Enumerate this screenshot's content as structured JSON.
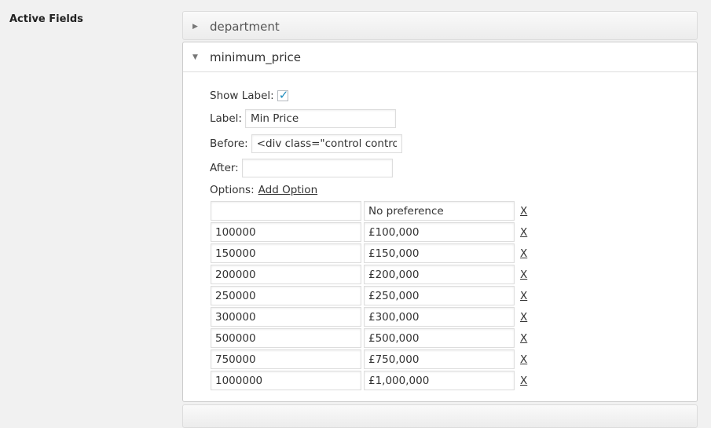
{
  "section_label": "Active Fields",
  "panels": {
    "department": "department",
    "minimum_price": "minimum_price"
  },
  "fields": {
    "show_label": "Show Label:",
    "show_label_checked": true,
    "label_label": "Label:",
    "label_value": "Min Price",
    "before_label": "Before:",
    "before_value": "<div class=\"control contro",
    "after_label": "After:",
    "after_value": "",
    "options_label": "Options:",
    "add_option": "Add Option"
  },
  "options": [
    {
      "key": "",
      "value": "No preference"
    },
    {
      "key": "100000",
      "value": "£100,000"
    },
    {
      "key": "150000",
      "value": "£150,000"
    },
    {
      "key": "200000",
      "value": "£200,000"
    },
    {
      "key": "250000",
      "value": "£250,000"
    },
    {
      "key": "300000",
      "value": "£300,000"
    },
    {
      "key": "500000",
      "value": "£500,000"
    },
    {
      "key": "750000",
      "value": "£750,000"
    },
    {
      "key": "1000000",
      "value": "£1,000,000"
    }
  ],
  "remove_label": "X"
}
